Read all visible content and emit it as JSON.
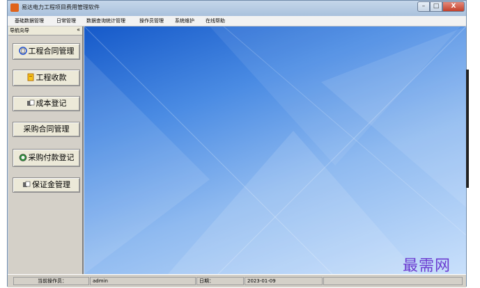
{
  "window": {
    "title": "易达电力工程项目费用管理软件",
    "controls": {
      "minimize": "–",
      "maximize": "□",
      "close": "X"
    }
  },
  "menubar": {
    "items": [
      "基础数据管理",
      "日常管理",
      "数据查询统计管理",
      "操作员管理",
      "系统维护",
      "在线帮助"
    ]
  },
  "sidebar": {
    "title": "导航向导",
    "collapse": "«",
    "items": [
      {
        "label": "工程合同管理",
        "icon": "contract-icon"
      },
      {
        "label": "工程收款",
        "icon": "receipt-icon"
      },
      {
        "label": "成本登记",
        "icon": "register-icon"
      },
      {
        "label": "采购合同管理",
        "icon": ""
      },
      {
        "label": "采购付款登记",
        "icon": "payment-icon"
      },
      {
        "label": "保证金管理",
        "icon": "deposit-icon"
      }
    ]
  },
  "statusbar": {
    "operator_label": "当前操作员：",
    "operator_value": "admin",
    "date_label": "日期：",
    "date_value": "2023-01-09"
  },
  "watermark": "最需网",
  "colors": {
    "content_top": "#1559c9",
    "content_bottom": "#c9e0fb",
    "watermark": "#6b3bd0"
  }
}
